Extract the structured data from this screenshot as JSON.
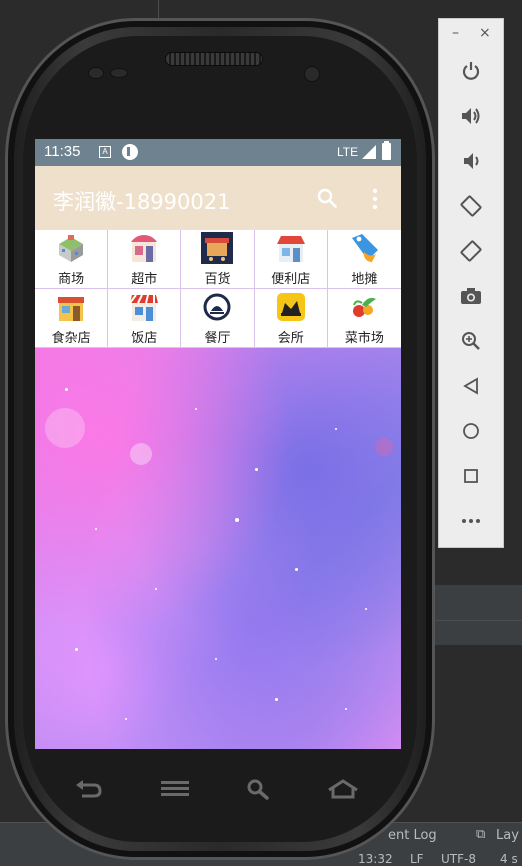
{
  "status_bar": {
    "time": "11:35",
    "network": "LTE",
    "notification_icon_a": "A",
    "icons": [
      "a-notification-icon",
      "p-notification-icon",
      "signal-icon",
      "battery-icon"
    ]
  },
  "app_bar": {
    "title": "李润徽-18990021",
    "background": "#efe0cc",
    "actions": [
      "search-icon",
      "more-vert-icon"
    ]
  },
  "categories": [
    {
      "label": "商场",
      "icon": "mall-icon"
    },
    {
      "label": "超市",
      "icon": "supermarket-icon"
    },
    {
      "label": "百货",
      "icon": "department-store-icon"
    },
    {
      "label": "便利店",
      "icon": "convenience-store-icon"
    },
    {
      "label": "地摊",
      "icon": "stall-tag-icon"
    },
    {
      "label": "食杂店",
      "icon": "grocery-icon"
    },
    {
      "label": "饭店",
      "icon": "restaurant-icon"
    },
    {
      "label": "餐厅",
      "icon": "dining-icon"
    },
    {
      "label": "会所",
      "icon": "club-icon"
    },
    {
      "label": "菜市场",
      "icon": "vegetable-market-icon"
    }
  ],
  "emulator_panel": {
    "minimize": "–",
    "close": "×",
    "buttons": [
      "power-icon",
      "volume-up-icon",
      "volume-down-icon",
      "rotate-left-icon",
      "rotate-right-icon",
      "camera-icon",
      "zoom-icon",
      "back-icon",
      "home-icon",
      "overview-icon",
      "more-icon"
    ]
  },
  "ide": {
    "event_log": "ent Log",
    "layout_tab": "Lay",
    "status_time": "13:32",
    "line_sep": "LF",
    "encoding": "UTF-8",
    "indent": "4 s"
  }
}
